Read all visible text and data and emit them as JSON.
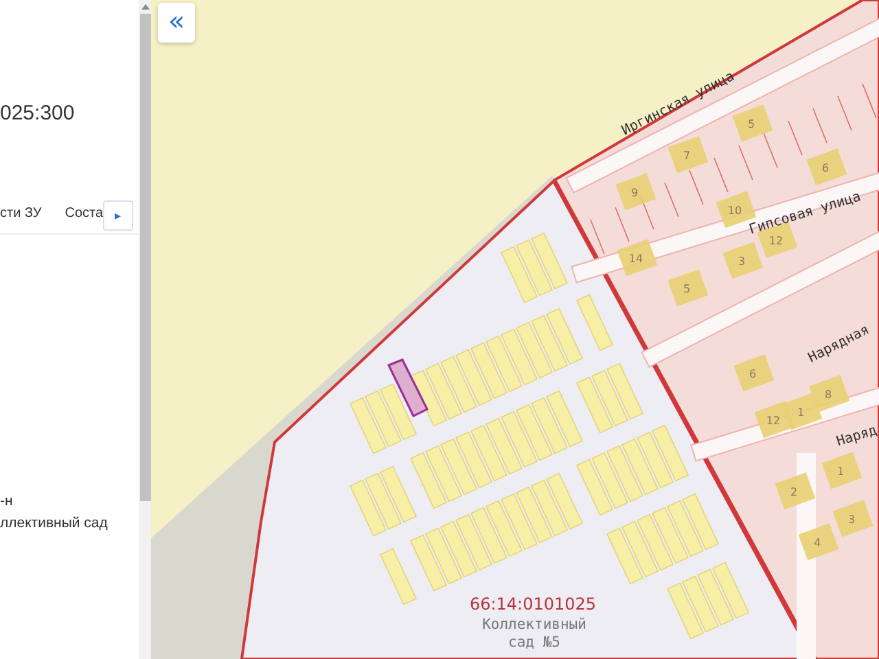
{
  "panel": {
    "title": "025:300",
    "tabs": [
      "сти ЗУ",
      "Соста"
    ],
    "tab_scroll_button": "▸",
    "address_lines": [
      "-н",
      "ллективный сад"
    ]
  },
  "map": {
    "collapse_button": "«",
    "streets": [
      "Иргинская улица",
      "Гипсовая улица",
      "Нарядная",
      "Наряд"
    ],
    "plot_numbers": [
      "9",
      "7",
      "5",
      "6",
      "10",
      "12",
      "14",
      "5",
      "3",
      "1",
      "6",
      "12",
      "8",
      "2",
      "1",
      "3",
      "4"
    ],
    "parcel_number": "66:14:0101025",
    "area_name": [
      "Коллективный",
      "сад №5"
    ]
  }
}
